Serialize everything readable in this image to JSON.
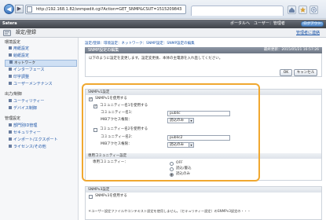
{
  "browser": {
    "address": "http://192.168.1.82/snmpedit.cgi?Action=GET_SNMP&CSUT=1515209843",
    "back_glyph": "◀",
    "forward_glyph": "▶"
  },
  "header": {
    "brand": "Satera",
    "links": [
      "ポータルへ",
      "ユーザー：管理者"
    ],
    "logout": "ログアウト"
  },
  "title": {
    "text": "設定/登録",
    "portal_link": "管理者に連絡"
  },
  "sidebar": {
    "sections": [
      {
        "heading": "環境設定",
        "items": [
          "用紙設定",
          "給紙設定",
          "ネットワーク",
          "インターフェース",
          "印字調整",
          "ユーザーメンテナンス"
        ]
      },
      {
        "heading": "出力/制御",
        "items": [
          "ユーティリティー",
          "デバイス制御"
        ]
      },
      {
        "heading": "管理設定",
        "items": [
          "部門別ID管理",
          "セキュリティー",
          "インポート/エクスポート",
          "ライセンス/その他"
        ]
      }
    ],
    "selected": "ネットワーク"
  },
  "breadcrumb": "設定/登録：環境設定：ネットワーク：SNMP設定：SNMP設定の編集",
  "panel": {
    "title": "SNMP設定の編集",
    "last_updated": "最終更新：2015/05/21 16:57:26",
    "description": "以下のように設定を変更します。設定変更後、本体の主電源を入れ直してください。",
    "ok": "OK",
    "cancel": "キャンセル"
  },
  "snmpv1": {
    "heading": "SNMPv1設定",
    "use_label": "SNMPv1を使用する",
    "community1": {
      "use_label": "コミュニティー名1を使用する",
      "name_label": "コミュニティー名1：",
      "name_value": "public",
      "mib_label": "MIBアクセス権限：",
      "mib_value": "読込のみ"
    },
    "community2": {
      "use_label": "コミュニティー名2を使用する",
      "name_label": "コミュニティー名2：",
      "name_value": "public2",
      "mib_label": "MIBアクセス権限：",
      "mib_value": "読込のみ"
    },
    "dedicated": {
      "heading": "専用コミュニティー設定",
      "label": "専用コミュニティー：",
      "options": [
        "OFF",
        "読込/書込",
        "読込のみ"
      ],
      "selected": "読込のみ"
    }
  },
  "snmpv3": {
    "heading": "SNMPv3設定",
    "use_label": "SNMPv3を使用する",
    "note": "＊ユーザー設定ファイルやコンテキスト設定を使用しません。（セキュリティー設定）のSNMPv3設定の・・・"
  },
  "colors": {
    "highlight": "#f0a830",
    "section_bar": "#7a8391",
    "link": "#1c55a8"
  }
}
